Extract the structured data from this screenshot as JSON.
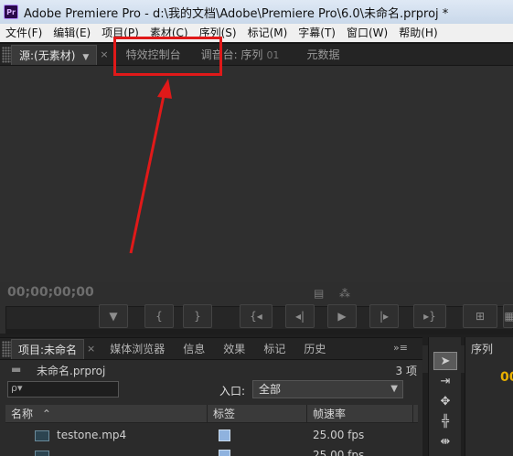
{
  "window": {
    "title": "Adobe Premiere Pro - d:\\我的文档\\Adobe\\Premiere Pro\\6.0\\未命名.prproj *",
    "logo": "Pr"
  },
  "menu": [
    "文件(F)",
    "编辑(E)",
    "项目(P)",
    "素材(C)",
    "序列(S)",
    "标记(M)",
    "字幕(T)",
    "窗口(W)",
    "帮助(H)"
  ],
  "source_panel": {
    "tabs": {
      "source": "源:(无素材)",
      "effect_controls": "特效控制台",
      "audio_mixer": "调音台: 序列",
      "audio_mixer_seq": "01",
      "metadata": "元数据"
    },
    "timecode": "00;00;00;00",
    "transport_icons": [
      "marker-in",
      "brace-left",
      "brace-right",
      "go-to-in",
      "step-back",
      "play",
      "step-forward",
      "go-to-out",
      "overlay"
    ]
  },
  "annotation": {
    "highlight_color": "#e01919",
    "target": "effect_controls_tab"
  },
  "project_panel": {
    "tabs": {
      "project": "项目:未命名",
      "media_browser": "媒体浏览器",
      "info": "信息",
      "effects": "效果",
      "markers": "标记",
      "history": "历史"
    },
    "project_file": "未命名.prproj",
    "item_count": "3 项",
    "search_placeholder": "ρ▾",
    "entry_label": "入口:",
    "entry_value": "全部",
    "columns": {
      "name": "名称",
      "label": "标签",
      "frame_rate": "帧速率"
    },
    "rows": [
      {
        "name": "testone.mp4",
        "frame_rate": "25.00 fps",
        "label_color": "#8fb2de"
      },
      {
        "name": "",
        "frame_rate": "25.00 fps",
        "label_color": "#8fb2de"
      }
    ]
  },
  "sequence_panel": {
    "tab": "序列",
    "timecode": "00"
  }
}
